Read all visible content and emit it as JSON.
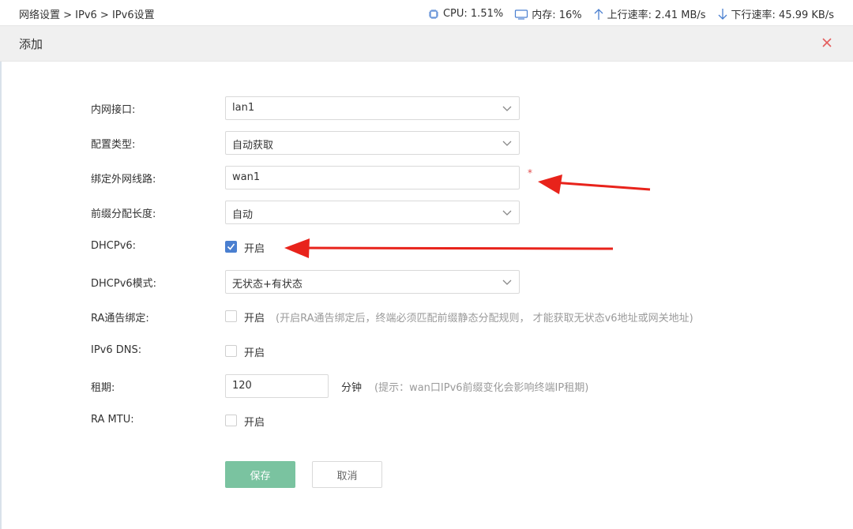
{
  "topbar": {
    "breadcrumb": "网络设置 > IPv6 > IPv6设置",
    "cpu": "CPU: 1.51%",
    "memory": "内存: 16%",
    "upload": "上行速率: 2.41 MB/s",
    "download": "下行速率: 45.99 KB/s"
  },
  "modal": {
    "title": "添加"
  },
  "form": {
    "lan_interface": {
      "label": "内网接口:",
      "value": "lan1"
    },
    "config_type": {
      "label": "配置类型:",
      "value": "自动获取"
    },
    "wan_line": {
      "label": "绑定外网线路:",
      "value": "wan1",
      "required": "*"
    },
    "prefix_length": {
      "label": "前缀分配长度:",
      "value": "自动"
    },
    "dhcpv6": {
      "label": "DHCPv6:",
      "option": "开启",
      "checked": true
    },
    "dhcpv6_mode": {
      "label": "DHCPv6模式:",
      "value": "无状态+有状态"
    },
    "ra_binding": {
      "label": "RA通告绑定:",
      "option": "开启",
      "checked": false,
      "hint": "(开启RA通告绑定后，终端必须匹配前缀静态分配规则， 才能获取无状态v6地址或网关地址)"
    },
    "ipv6_dns": {
      "label": "IPv6 DNS:",
      "option": "开启",
      "checked": false
    },
    "lease": {
      "label": "租期:",
      "value": "120",
      "unit": "分钟",
      "hint": "(提示：wan口IPv6前缀变化会影响终端IP租期)"
    },
    "ra_mtu": {
      "label": "RA MTU:",
      "option": "开启",
      "checked": false
    }
  },
  "buttons": {
    "save": "保存",
    "cancel": "取消"
  },
  "colors": {
    "accent_green": "#7ac3a0",
    "checkbox_blue": "#4a7fd0",
    "annotation_red": "#e8231b"
  }
}
